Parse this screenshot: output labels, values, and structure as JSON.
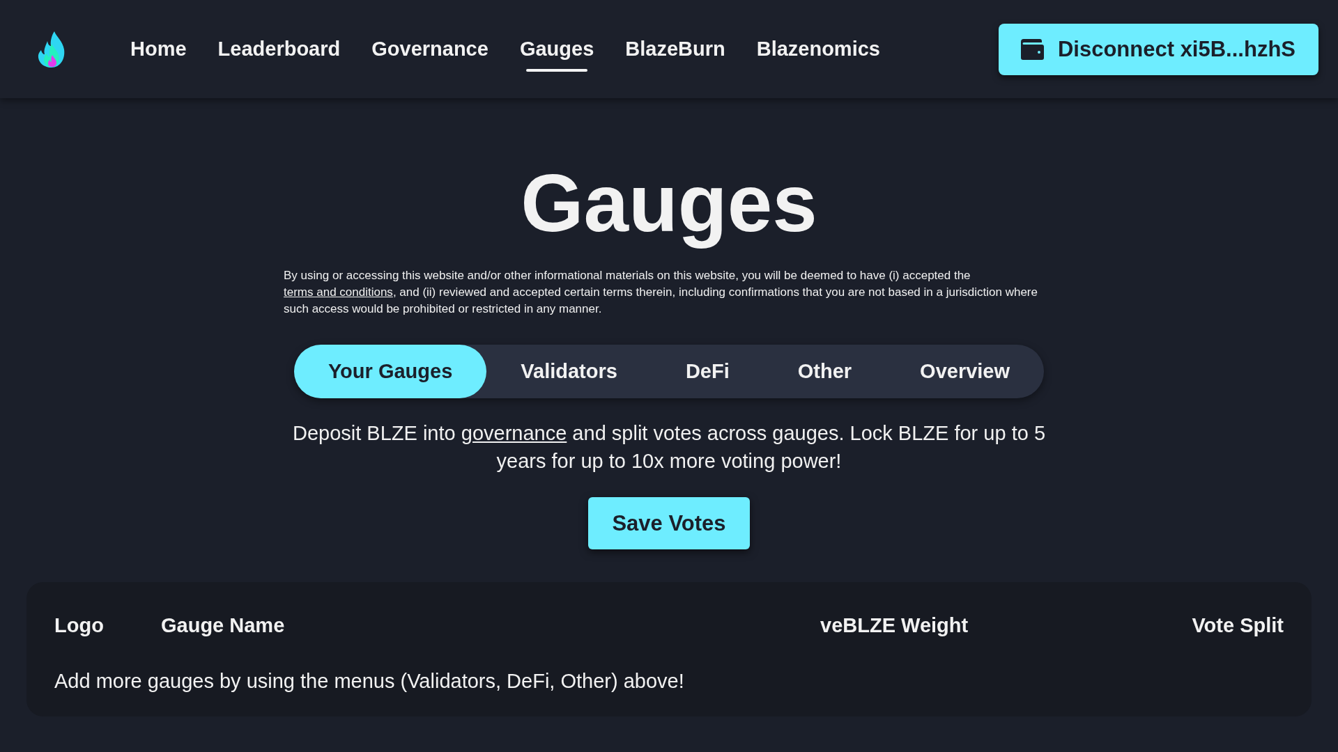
{
  "header": {
    "nav": [
      {
        "label": "Home",
        "selected": false
      },
      {
        "label": "Leaderboard",
        "selected": false
      },
      {
        "label": "Governance",
        "selected": false
      },
      {
        "label": "Gauges",
        "selected": true
      },
      {
        "label": "BlazeBurn",
        "selected": false
      },
      {
        "label": "Blazenomics",
        "selected": false
      }
    ],
    "wallet_button": "Disconnect xi5B...hzhS"
  },
  "title": "Gauges",
  "disclaimer": {
    "before": "By using or accessing this website and/or other informational materials on this website, you will be deemed to have (i) accepted the ",
    "link": "terms and conditions",
    "after": ", and (ii) reviewed and accepted certain terms therein, including confirmations that you are not based in a jurisdiction where such access would be prohibited or restricted in any manner."
  },
  "tabs": [
    {
      "label": "Your Gauges",
      "selected": true
    },
    {
      "label": "Validators",
      "selected": false
    },
    {
      "label": "DeFi",
      "selected": false
    },
    {
      "label": "Other",
      "selected": false
    },
    {
      "label": "Overview",
      "selected": false
    }
  ],
  "intro": {
    "before": "Deposit BLZE into ",
    "link": "governance",
    "after": " and split votes across gauges. Lock BLZE for up to 5 years for up to 10x more voting power!"
  },
  "save_button": "Save Votes",
  "table": {
    "columns": [
      "Logo",
      "Gauge Name",
      "veBLZE Weight",
      "Vote Split"
    ],
    "empty_message": "Add more gauges by using the menus (Validators, DeFi, Other) above!"
  }
}
